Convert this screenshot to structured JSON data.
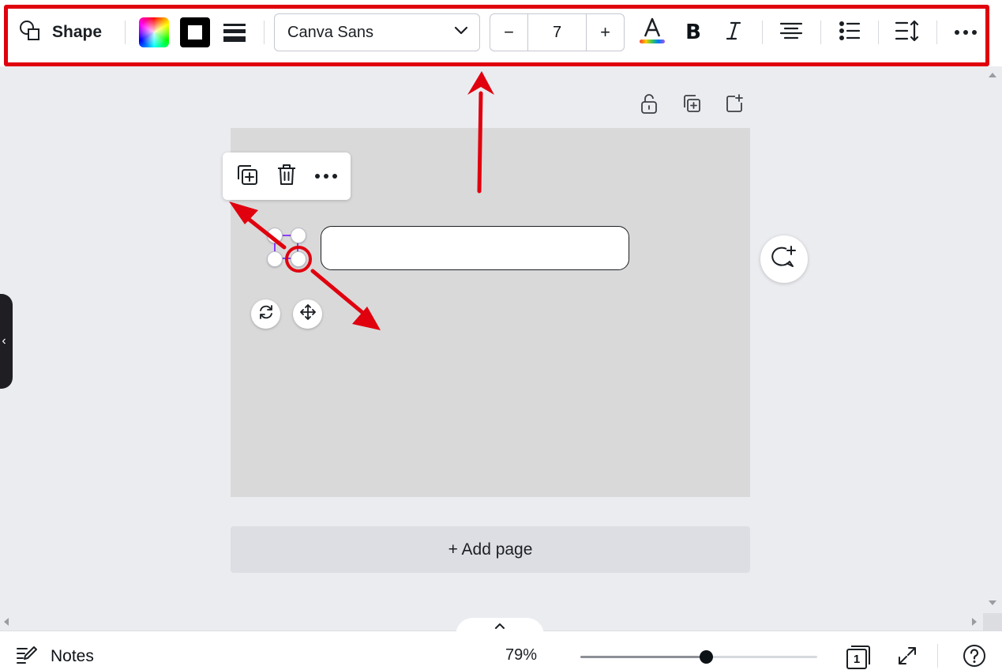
{
  "toolbar": {
    "shape_label": "Shape",
    "font_name": "Canva Sans",
    "font_size": "7",
    "size_minus": "−",
    "size_plus": "+",
    "icons": {
      "shape": "shapes-icon",
      "fill_color": "color-swatch-gradient",
      "border_color": "border-color-swatch",
      "border_style": "border-style-icon",
      "font_dropdown": "chevron-down-icon",
      "text_color": "text-color-icon",
      "bold": "bold-icon",
      "italic": "italic-icon",
      "align": "align-center-icon",
      "list": "bullet-list-icon",
      "spacing": "line-spacing-icon",
      "more": "more-horizontal-icon"
    }
  },
  "page_tools": [
    "lock-icon",
    "duplicate-page-icon",
    "add-page-icon"
  ],
  "context_menu": [
    "duplicate-icon",
    "trash-icon",
    "more-horizontal-icon"
  ],
  "canvas": {
    "add_page_label": "+ Add page",
    "highlight_color": "#e0000e",
    "selection_color": "#8b3dff",
    "page_color": "#d9d9d9"
  },
  "footer": {
    "notes_label": "Notes",
    "zoom_label": "79%",
    "zoom_fraction": 0.53,
    "page_count": "1"
  }
}
